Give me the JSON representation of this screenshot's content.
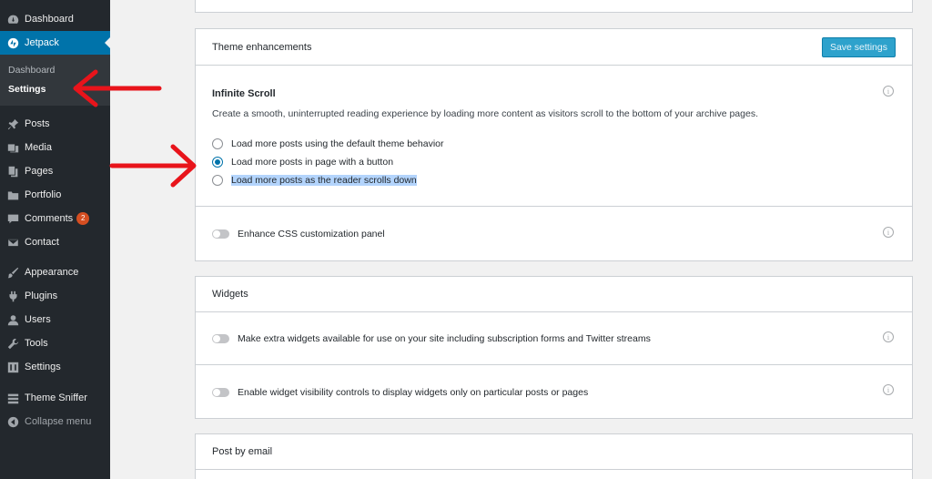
{
  "sidebar": {
    "items": [
      {
        "label": "Dashboard",
        "icon": "dashboard-icon"
      },
      {
        "label": "Jetpack",
        "icon": "jetpack-icon"
      },
      {
        "label": "Posts",
        "icon": "pin-icon"
      },
      {
        "label": "Media",
        "icon": "media-icon"
      },
      {
        "label": "Pages",
        "icon": "pages-icon"
      },
      {
        "label": "Portfolio",
        "icon": "portfolio-icon"
      },
      {
        "label": "Comments",
        "icon": "comments-icon",
        "badge": "2"
      },
      {
        "label": "Contact",
        "icon": "mail-icon"
      },
      {
        "label": "Appearance",
        "icon": "brush-icon"
      },
      {
        "label": "Plugins",
        "icon": "plugin-icon"
      },
      {
        "label": "Users",
        "icon": "users-icon"
      },
      {
        "label": "Tools",
        "icon": "wrench-icon"
      },
      {
        "label": "Settings",
        "icon": "settings-icon"
      },
      {
        "label": "Theme Sniffer",
        "icon": "theme-sniffer-icon"
      },
      {
        "label": "Collapse menu",
        "icon": "collapse-icon"
      }
    ],
    "submenu": [
      {
        "label": "Dashboard"
      },
      {
        "label": "Settings"
      }
    ]
  },
  "theme_enhancements": {
    "title": "Theme enhancements",
    "save_label": "Save settings",
    "infinite_scroll": {
      "title": "Infinite Scroll",
      "description": "Create a smooth, uninterrupted reading experience by loading more content as visitors scroll to the bottom of your archive pages.",
      "options": [
        {
          "label": "Load more posts using the default theme behavior",
          "checked": false
        },
        {
          "label": "Load more posts in page with a button",
          "checked": true
        },
        {
          "label": "Load more posts as the reader scrolls down",
          "checked": false
        }
      ]
    },
    "css_toggle": {
      "label": "Enhance CSS customization panel",
      "on": false
    }
  },
  "widgets": {
    "title": "Widgets",
    "toggles": [
      {
        "label": "Make extra widgets available for use on your site including subscription forms and Twitter streams",
        "on": false
      },
      {
        "label": "Enable widget visibility controls to display widgets only on particular posts or pages",
        "on": false
      }
    ]
  },
  "post_by_email": {
    "title": "Post by email"
  },
  "colors": {
    "arrow": "#e8141b",
    "accent": "#0073aa"
  }
}
